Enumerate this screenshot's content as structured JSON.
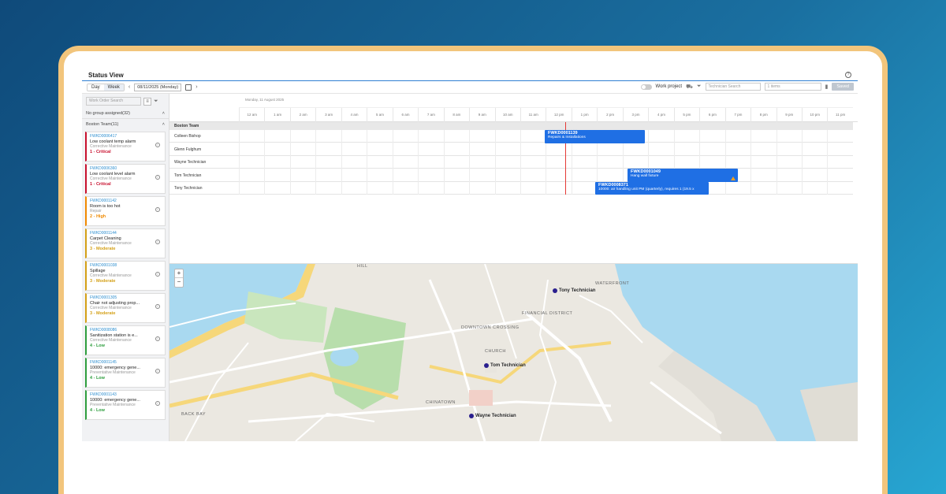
{
  "app": {
    "title": "Status View",
    "help_icon": "?"
  },
  "toolbar": {
    "day": "Day",
    "week": "Week",
    "date": "08/11/2025 (Monday)",
    "work_project": "Work project",
    "technician_search_placeholder": "Technician Search",
    "items_select": "1 items",
    "save": "Saved"
  },
  "sidebar": {
    "search_placeholder": "Work Order Search",
    "no_group": "No group assigned(32)",
    "boston_team": "Boston Team(11)",
    "cards": [
      {
        "id": "FWKD0006417",
        "title": "Low coolant temp alarm",
        "type": "Corrective Maintenance",
        "priority": "1 - Critical",
        "color": "#c8102e"
      },
      {
        "id": "FWKD0006360",
        "title": "Low coolant level alarm",
        "type": "Corrective Maintenance",
        "priority": "1 - Critical",
        "color": "#c8102e"
      },
      {
        "id": "FWKD0001142",
        "title": "Room is too hot",
        "type": "Repair",
        "priority": "2 - High",
        "color": "#f08a00"
      },
      {
        "id": "FWKD0001144",
        "title": "Carpet Cleaning",
        "type": "Corrective Maintenance",
        "priority": "3 - Moderate",
        "color": "#d4a017"
      },
      {
        "id": "FWKD0001038",
        "title": "Spillage",
        "type": "Corrective Maintenance",
        "priority": "3 - Moderate",
        "color": "#d4a017"
      },
      {
        "id": "FWKD0001305",
        "title": "Chair not adjusting prop...",
        "type": "Corrective Maintenance",
        "priority": "3 - Moderate",
        "color": "#d4a017"
      },
      {
        "id": "FWKD0008086",
        "title": "Sanitization station is e...",
        "type": "Corrective Maintenance",
        "priority": "4 - Low",
        "color": "#2e9e3e"
      },
      {
        "id": "FWKD0001145",
        "title": "10000: emergency gene...",
        "type": "Preventative Maintenance",
        "priority": "4 - Low",
        "color": "#2e9e3e"
      },
      {
        "id": "FWKD0001143",
        "title": "10000: emergency gene...",
        "type": "Preventative Maintenance",
        "priority": "4 - Low",
        "color": "#2e9e3e"
      }
    ]
  },
  "schedule": {
    "date_label": "Monday, 11 August 2025",
    "hours": [
      "12 am",
      "1 am",
      "2 am",
      "3 am",
      "4 am",
      "5 am",
      "6 am",
      "7 am",
      "8 am",
      "9 am",
      "10 am",
      "11 am",
      "12 pm",
      "1 pm",
      "2 pm",
      "3 pm",
      "4 pm",
      "5 pm",
      "6 pm",
      "7 pm",
      "8 pm",
      "9 pm",
      "10 pm",
      "11 pm"
    ],
    "team": "Boston Team",
    "technicians": [
      "Colleen Bishop",
      "Glenn Fulghum",
      "Wayne Technician",
      "Tom Technician",
      "Tony Technician"
    ],
    "events": [
      {
        "id": "FWKD0001139",
        "desc": "Repairs & Installations"
      },
      {
        "id": "FWKD0001049",
        "desc": "Hang wall fixture"
      },
      {
        "id": "FWKD0008371",
        "desc": "10000: air handling unit PM (quarterly), requires 1 (19.5 x"
      }
    ]
  },
  "map": {
    "zoom_in": "+",
    "zoom_out": "−",
    "markers": [
      "Tony Technician",
      "Tom Technician",
      "Wayne Technician"
    ],
    "areas": [
      "FINANCIAL DISTRICT",
      "DOWNTOWN CROSSING",
      "CHINATOWN",
      "BACK BAY",
      "WATERFRONT",
      "HILL",
      "CHURCH"
    ]
  }
}
